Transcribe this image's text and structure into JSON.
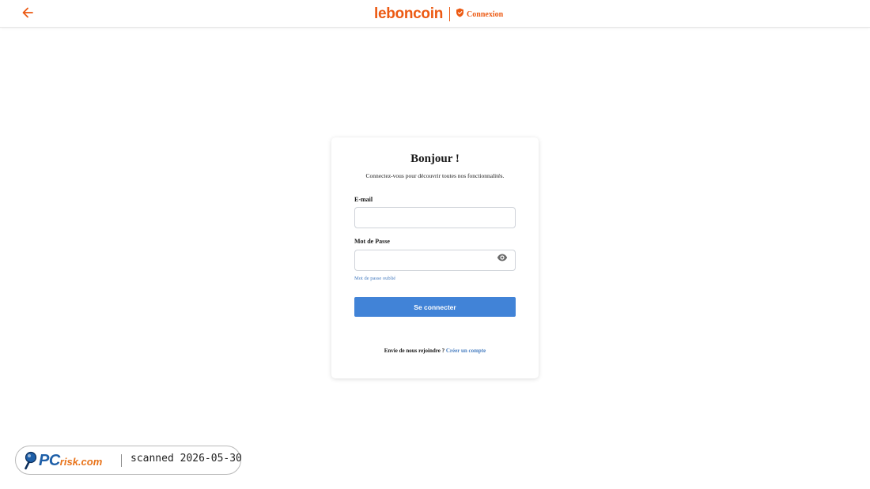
{
  "header": {
    "logo": "leboncoin",
    "page_label": "Connexion",
    "back_icon": "arrow-left-icon",
    "shield_icon": "shield-icon"
  },
  "login": {
    "title": "Bonjour !",
    "subtitle": "Connectez-vous pour découvrir toutes nos fonctionnalités.",
    "email_label": "E-mail",
    "email_value": "",
    "password_label": "Mot de Passe",
    "password_value": "",
    "toggle_visibility_icon": "eye-icon",
    "forgot_link": "Mot de passe oublié",
    "submit_label": "Se connecter",
    "signup_prompt": "Envie de nous rejoindre ?",
    "signup_link": "Créer un compte"
  },
  "watermark": {
    "brand_main": "PC",
    "brand_rest": "risk.com",
    "scan_text": "scanned 2026-05-30"
  },
  "colors": {
    "brand_orange": "#ec5a13",
    "button_blue": "#4183d7",
    "link_blue": "#4a7fc1"
  }
}
